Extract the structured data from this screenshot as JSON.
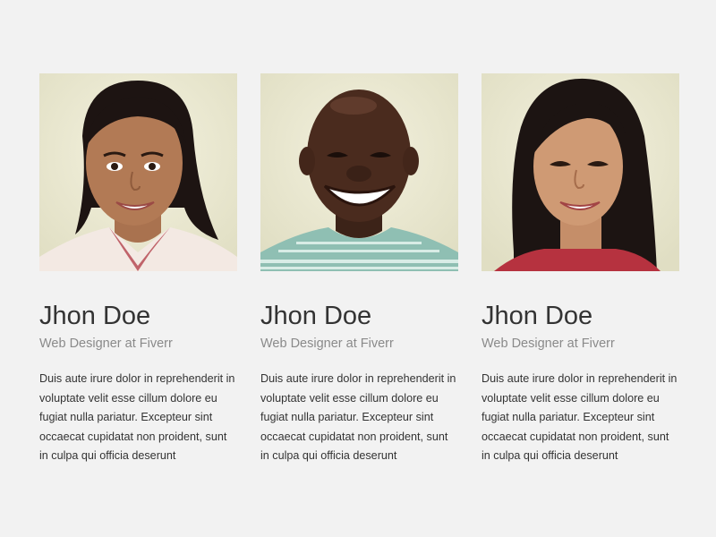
{
  "team": [
    {
      "name": "Jhon Doe",
      "role": "Web Designer at Fiverr",
      "bio": "Duis aute irure dolor in reprehenderit in voluptate velit esse cillum dolore eu fugiat nulla pariatur. Excepteur sint occaecat cupidatat non proident, sunt in culpa qui officia deserunt"
    },
    {
      "name": "Jhon Doe",
      "role": "Web Designer at Fiverr",
      "bio": "Duis aute irure dolor in reprehenderit in voluptate velit esse cillum dolore eu fugiat nulla pariatur. Excepteur sint occaecat cupidatat non proident, sunt in culpa qui officia deserunt"
    },
    {
      "name": "Jhon Doe",
      "role": "Web Designer at Fiverr",
      "bio": "Duis aute irure dolor in reprehenderit in voluptate velit esse cillum dolore eu fugiat nulla pariatur. Excepteur sint occaecat cupidatat non proident, sunt in culpa qui officia deserunt"
    }
  ],
  "colors": {
    "page_background": "#f2f2f2",
    "photo_background": "#eeecd6",
    "name_text": "#333333",
    "role_text": "#8a8a8a",
    "body_text": "#333333"
  }
}
